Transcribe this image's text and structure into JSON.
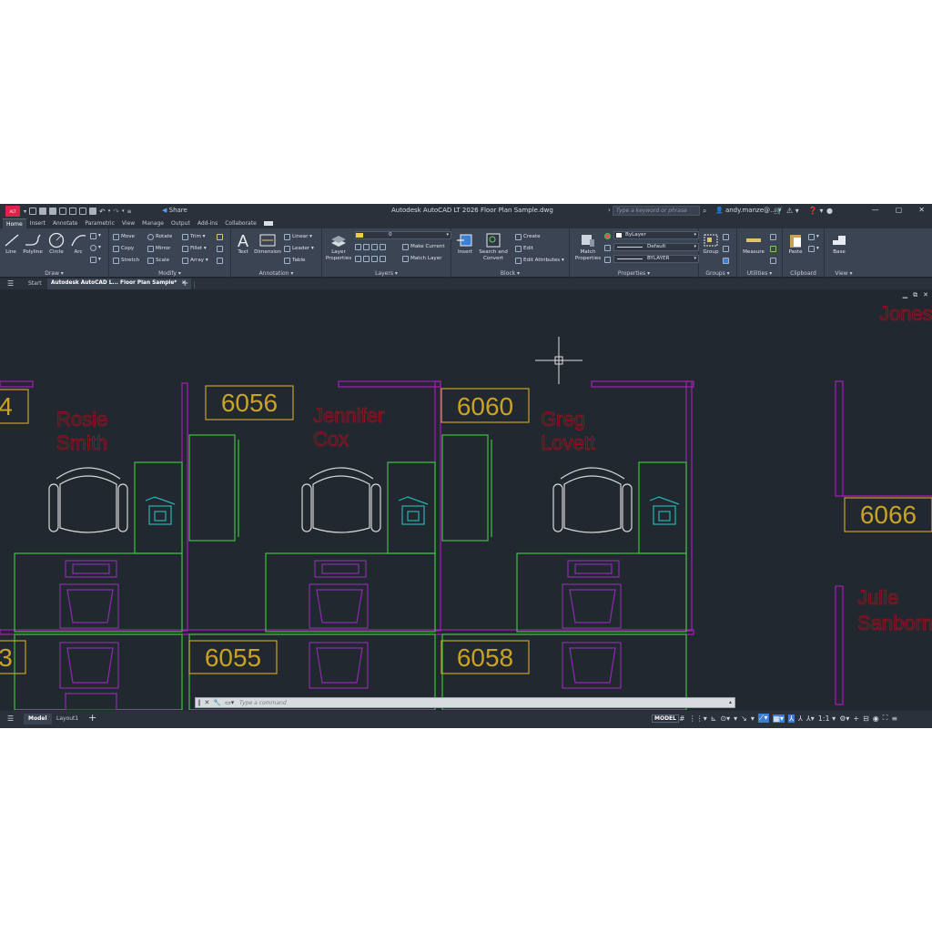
{
  "titlebar": {
    "logo": "A",
    "logo_sub": "LT",
    "share": "Share",
    "window_title": "Autodesk AutoCAD LT 2026  Floor Plan Sample.dwg",
    "search_placeholder": "Type a keyword or phrase",
    "user": "andy.manze@...",
    "controls": [
      "—",
      "▢",
      "✕"
    ]
  },
  "ribbon_tabs": [
    "Home",
    "Insert",
    "Annotate",
    "Parametric",
    "View",
    "Manage",
    "Output",
    "Add-ins",
    "Collaborate"
  ],
  "ribbon": {
    "draw": {
      "title": "Draw ▾",
      "line": "Line",
      "polyline": "Polyline",
      "circle": "Circle",
      "arc": "Arc"
    },
    "modify": {
      "title": "Modify ▾",
      "move": "Move",
      "rotate": "Rotate",
      "trim": "Trim ▾",
      "copy": "Copy",
      "mirror": "Mirror",
      "fillet": "Fillet ▾",
      "stretch": "Stretch",
      "scale": "Scale",
      "array": "Array ▾"
    },
    "annotation": {
      "title": "Annotation ▾",
      "text": "Text",
      "dimension": "Dimension",
      "linear": "Linear ▾",
      "leader": "Leader ▾",
      "table": "Table"
    },
    "layers": {
      "title": "Layers ▾",
      "layer_properties_1": "Layer",
      "layer_properties_2": "Properties",
      "layer_value": "0",
      "make_current": "Make Current",
      "match_layer": "Match Layer"
    },
    "block": {
      "title": "Block ▾",
      "insert": "Insert",
      "search_convert_1": "Search and",
      "search_convert_2": "Convert",
      "create": "Create",
      "edit": "Edit",
      "edit_attributes": "Edit Attributes ▾"
    },
    "properties": {
      "title": "Properties ▾",
      "match_1": "Match",
      "match_2": "Properties",
      "color": "ByLayer",
      "linetype": "Default",
      "lineweight": "BYLAYER"
    },
    "groups": {
      "title": "Groups ▾",
      "group": "Group"
    },
    "utilities": {
      "title": "Utilities ▾",
      "measure": "Measure"
    },
    "clipboard": {
      "title": "Clipboard",
      "paste": "Paste"
    },
    "view": {
      "title": "View ▾",
      "base": "Base"
    }
  },
  "file_tabs": {
    "start": "Start",
    "doc": "Autodesk AutoCAD L...  Floor Plan Sample*",
    "close": "×",
    "plus": "+"
  },
  "drawing": {
    "rooms": [
      "6056",
      "6060",
      "6066",
      "6055",
      "6058"
    ],
    "partial_rooms": [
      "4",
      "3"
    ],
    "names": {
      "rosie_1": "Rosie",
      "rosie_2": "Smith",
      "jennifer_1": "Jennifer",
      "jennifer_2": "Cox",
      "greg_1": "Greg",
      "greg_2": "Lovett",
      "julie_1": "Julie",
      "julie_2": "Sanborn",
      "jones": "Jones"
    },
    "colors": {
      "wall": "#a41fb7",
      "furniture": "#3fc13f",
      "room_label": "#c9a227",
      "name_text": "#8a1520",
      "chair": "#d8d8d8",
      "phone": "#27b5b5"
    }
  },
  "command_line": {
    "placeholder": "Type a command"
  },
  "status_bar": {
    "model_tab": "Model",
    "layout_tab": "Layout1",
    "plus": "+",
    "space": "MODEL",
    "scale": "1:1 ▾"
  }
}
